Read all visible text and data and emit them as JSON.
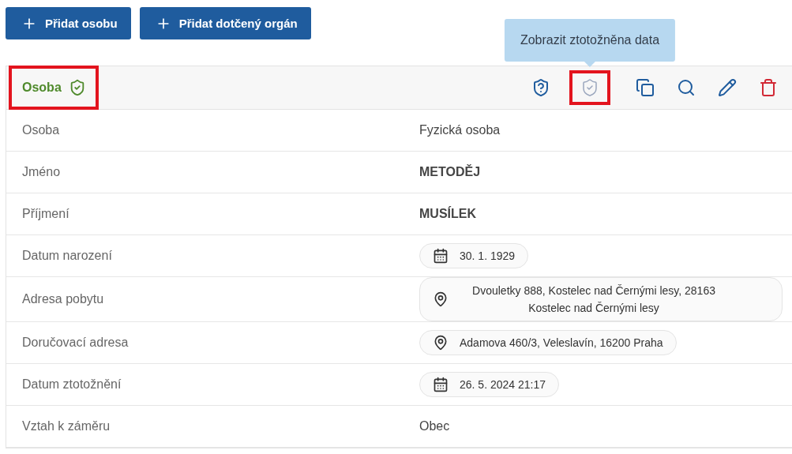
{
  "buttons": [
    {
      "label": "Přidat osobu"
    },
    {
      "label": "Přidat dotčený orgán"
    }
  ],
  "card": {
    "title": "Osoba",
    "verified": true,
    "highlighted": true,
    "actions": [
      {
        "kind": "unknown-identity",
        "disabled": false,
        "highlighted": false
      },
      {
        "kind": "identified",
        "disabled": true,
        "highlighted": true,
        "tooltip": "Zobrazit ztotožněna data"
      },
      {
        "kind": "copy",
        "disabled": false,
        "highlighted": false
      },
      {
        "kind": "search",
        "disabled": false,
        "highlighted": false
      },
      {
        "kind": "edit",
        "disabled": false,
        "highlighted": false
      },
      {
        "kind": "delete",
        "disabled": false,
        "highlighted": false
      }
    ],
    "rows": [
      {
        "label": "Osoba",
        "kind": "text",
        "value": "Fyzická osoba"
      },
      {
        "label": "Jméno",
        "kind": "bold",
        "value": "METODĚJ"
      },
      {
        "label": "Příjmení",
        "kind": "bold",
        "value": "MUSÍLEK"
      },
      {
        "label": "Datum narození",
        "kind": "date",
        "value": "30. 1. 1929"
      },
      {
        "label": "Adresa pobytu",
        "kind": "address",
        "value": "Dvouletky 888, Kostelec nad Černými lesy, 28163 Kostelec nad Černými lesy"
      },
      {
        "label": "Doručovací adresa",
        "kind": "address",
        "value": "Adamova 460/3, Veleslavín, 16200 Praha"
      },
      {
        "label": "Datum ztotožnění",
        "kind": "date",
        "value": "26. 5. 2024 21:17"
      },
      {
        "label": "Vztah k záměru",
        "kind": "text",
        "value": "Obec"
      }
    ]
  }
}
